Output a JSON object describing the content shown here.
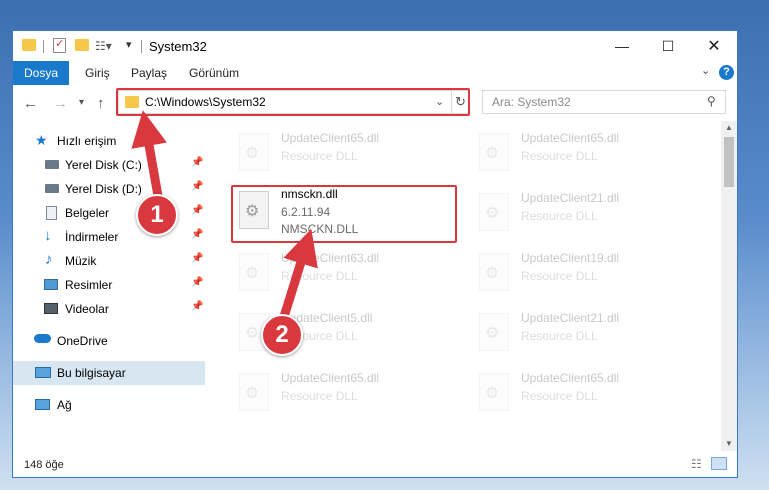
{
  "window": {
    "title": "System32"
  },
  "ribbon": {
    "tabs": [
      "Dosya",
      "Giriş",
      "Paylaş",
      "Görünüm"
    ]
  },
  "address": {
    "path": "C:\\Windows\\System32"
  },
  "search": {
    "placeholder": "Ara: System32"
  },
  "sidebar": {
    "quick_access": "Hızlı erişim",
    "items": [
      {
        "label": "Yerel Disk (C:)",
        "icon": "drive-icon"
      },
      {
        "label": "Yerel Disk (D:)",
        "icon": "drive-icon"
      },
      {
        "label": "Belgeler",
        "icon": "documents-icon"
      },
      {
        "label": "İndirmeler",
        "icon": "download-icon"
      },
      {
        "label": "Müzik",
        "icon": "music-icon"
      },
      {
        "label": "Resimler",
        "icon": "pictures-icon"
      },
      {
        "label": "Videolar",
        "icon": "videos-icon"
      }
    ],
    "onedrive": "OneDrive",
    "this_pc": "Bu bilgisayar",
    "network": "Ağ"
  },
  "files": {
    "selected": {
      "name": "nmsckn.dll",
      "version": "6.2.11.94",
      "desc": "NMSCKN.DLL"
    },
    "left": [
      {
        "name": "UpdateClient65.dll",
        "desc": "Resource DLL"
      },
      {
        "name": "UpdateClient63.dll",
        "desc": "Resource DLL"
      },
      {
        "name": "UpdateClient5.dll",
        "desc": "Resource DLL"
      },
      {
        "name": "UpdateClient65.dll",
        "desc": "Resource DLL"
      }
    ],
    "right": [
      {
        "name": "UpdateClient65.dll",
        "desc": "Resource DLL"
      },
      {
        "name": "UpdateClient21.dll",
        "desc": "Resource DLL"
      },
      {
        "name": "UpdateClient19.dll",
        "desc": "Resource DLL"
      },
      {
        "name": "UpdateClient21.dll",
        "desc": "Resource DLL"
      },
      {
        "name": "UpdateClient65.dll",
        "desc": "Resource DLL"
      }
    ]
  },
  "status": {
    "count": "148 öğe"
  },
  "annotations": {
    "step1": "1",
    "step2": "2"
  },
  "colors": {
    "accent": "#1979ca",
    "highlight": "#d9383e"
  }
}
